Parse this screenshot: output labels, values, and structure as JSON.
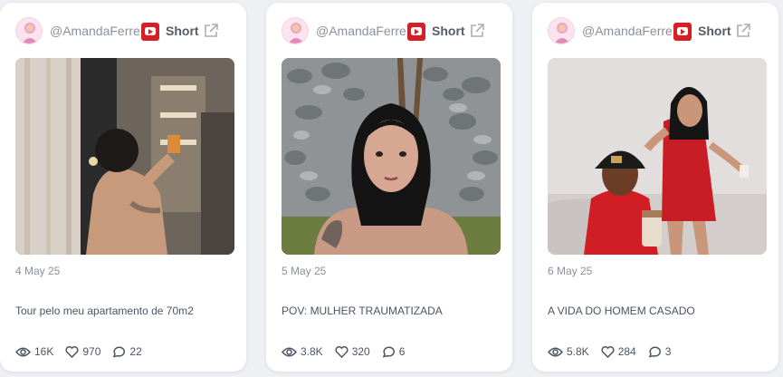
{
  "posts": [
    {
      "author_handle": "@AmandaFerre...",
      "platform": "youtube",
      "type_label": "Short",
      "date": "4 May 25",
      "caption": "Tour pelo meu apartamento de 70m2",
      "views": "16K",
      "likes": "970",
      "comments": "22"
    },
    {
      "author_handle": "@AmandaFerre...",
      "platform": "youtube",
      "type_label": "Short",
      "date": "5 May 25",
      "caption": "POV: MULHER TRAUMATIZADA",
      "views": "3.8K",
      "likes": "320",
      "comments": "6"
    },
    {
      "author_handle": "@AmandaFerre...",
      "platform": "youtube",
      "type_label": "Short",
      "date": "6 May 25",
      "caption": "A VIDA DO HOMEM CASADO",
      "views": "5.8K",
      "likes": "284",
      "comments": "3"
    }
  ],
  "icons": {
    "platform": "youtube-icon",
    "external": "external-link-icon",
    "views": "eye-icon",
    "likes": "heart-icon",
    "comments": "comment-icon"
  },
  "colors": {
    "background": "#eef0f4",
    "card": "#ffffff",
    "youtube_red": "#d81f26",
    "muted_text": "#8a919d"
  }
}
